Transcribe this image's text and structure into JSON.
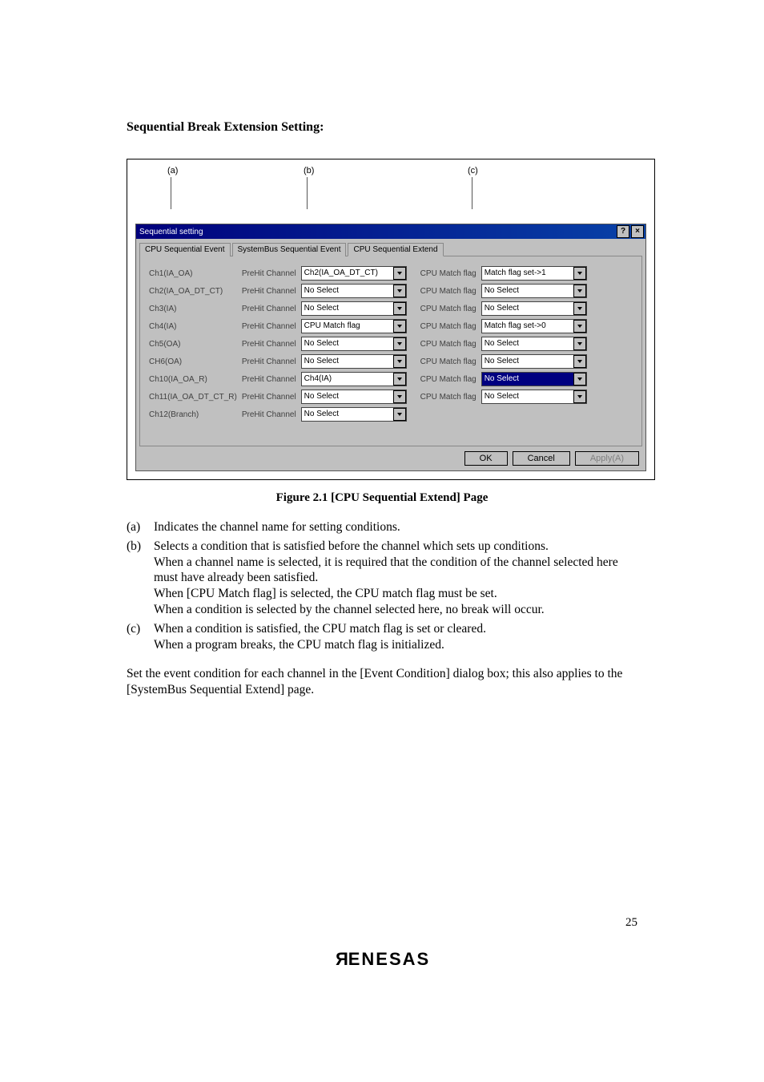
{
  "section_title": "Sequential Break Extension Setting:",
  "labels": {
    "a": "(a)",
    "b": "(b)",
    "c": "(c)"
  },
  "dialog": {
    "title": "Sequential setting",
    "help_btn": "?",
    "close_btn": "×",
    "tabs": {
      "t1": "CPU Sequential Event",
      "t2": "SystemBus Sequential Event",
      "t3": "CPU Sequential Extend"
    },
    "col": {
      "prehit": "PreHit Channel",
      "match": "CPU Match flag"
    },
    "rows": [
      {
        "ch": "Ch1(IA_OA)",
        "pre": "Ch2(IA_OA_DT_CT)",
        "mf": "Match flag set->1",
        "mf_hl": false
      },
      {
        "ch": "Ch2(IA_OA_DT_CT)",
        "pre": "No Select",
        "mf": "No Select",
        "mf_hl": false
      },
      {
        "ch": "Ch3(IA)",
        "pre": "No Select",
        "mf": "No Select",
        "mf_hl": false
      },
      {
        "ch": "Ch4(IA)",
        "pre": "CPU Match flag",
        "mf": "Match flag set->0",
        "mf_hl": false
      },
      {
        "ch": "Ch5(OA)",
        "pre": "No Select",
        "mf": "No Select",
        "mf_hl": false
      },
      {
        "ch": "CH6(OA)",
        "pre": "No Select",
        "mf": "No Select",
        "mf_hl": false
      },
      {
        "ch": "Ch10(IA_OA_R)",
        "pre": "Ch4(IA)",
        "mf": "No Select",
        "mf_hl": true
      },
      {
        "ch": "Ch11(IA_OA_DT_CT_R)",
        "pre": "No Select",
        "mf": "No Select",
        "mf_hl": false
      },
      {
        "ch": "Ch12(Branch)",
        "pre": "No Select",
        "mf": "",
        "mf_hl": false
      }
    ],
    "buttons": {
      "ok": "OK",
      "cancel": "Cancel",
      "apply": "Apply(A)"
    }
  },
  "caption": "Figure 2.1   [CPU Sequential Extend] Page",
  "items": {
    "a_mk": "(a)",
    "a": "Indicates the channel name for setting conditions.",
    "b_mk": "(b)",
    "b1": "Selects a condition that is satisfied before the channel which sets up conditions.",
    "b2": "When a channel name is selected, it is required that the condition of the channel selected here must have already been satisfied.",
    "b3": "When [CPU Match flag] is selected, the CPU match flag must be set.",
    "b4": "When a condition is selected by the channel selected here, no break will occur.",
    "c_mk": "(c)",
    "c1": "When a condition is satisfied, the CPU match flag is set or cleared.",
    "c2": "When a program breaks, the CPU match flag is initialized."
  },
  "para": "Set the event condition for each channel in the [Event Condition] dialog box; this also applies to the [SystemBus Sequential Extend] page.",
  "pageno": "25",
  "logo_left": "R",
  "logo_rest": "ENESAS"
}
